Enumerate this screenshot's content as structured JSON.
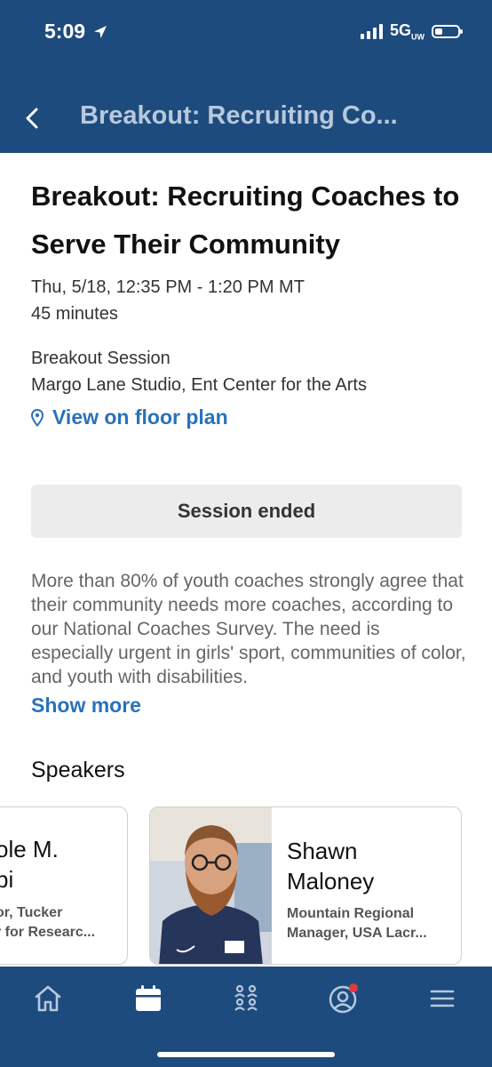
{
  "status_bar": {
    "time": "5:09",
    "network": "5G",
    "network_sup": "UW"
  },
  "nav": {
    "title": "Breakout: Recruiting Co..."
  },
  "session": {
    "title": "Breakout: Recruiting Coaches to Serve Their Community",
    "datetime": "Thu, 5/18, 12:35 PM - 1:20 PM MT",
    "duration": "45 minutes",
    "type": "Breakout Session",
    "location": "Margo Lane Studio, Ent Center for the Arts",
    "floor_plan_link": "View on floor plan",
    "status": "Session ended",
    "description": "More than 80% of youth coaches strongly agree that their community needs more coaches, according to our National Coaches Survey. The need is especially urgent in girls' sport, communities of color, and youth with disabilities.",
    "show_more": "Show more"
  },
  "speakers": {
    "heading": "Speakers",
    "items": [
      {
        "name_line1": "ole M.",
        "name_line2": "bi",
        "role_line1": "or, Tucker",
        "role_line2": "r for Researc..."
      },
      {
        "name_line1": "Shawn",
        "name_line2": "Maloney",
        "role_line1": "Mountain Regional",
        "role_line2": "Manager, USA Lacr..."
      }
    ]
  },
  "tabbar": {
    "items": [
      "home-icon",
      "calendar-icon",
      "people-icon",
      "profile-icon",
      "menu-icon"
    ]
  },
  "colors": {
    "brand": "#1e4b7d",
    "link": "#2a72b8",
    "notification": "#e0393e"
  }
}
